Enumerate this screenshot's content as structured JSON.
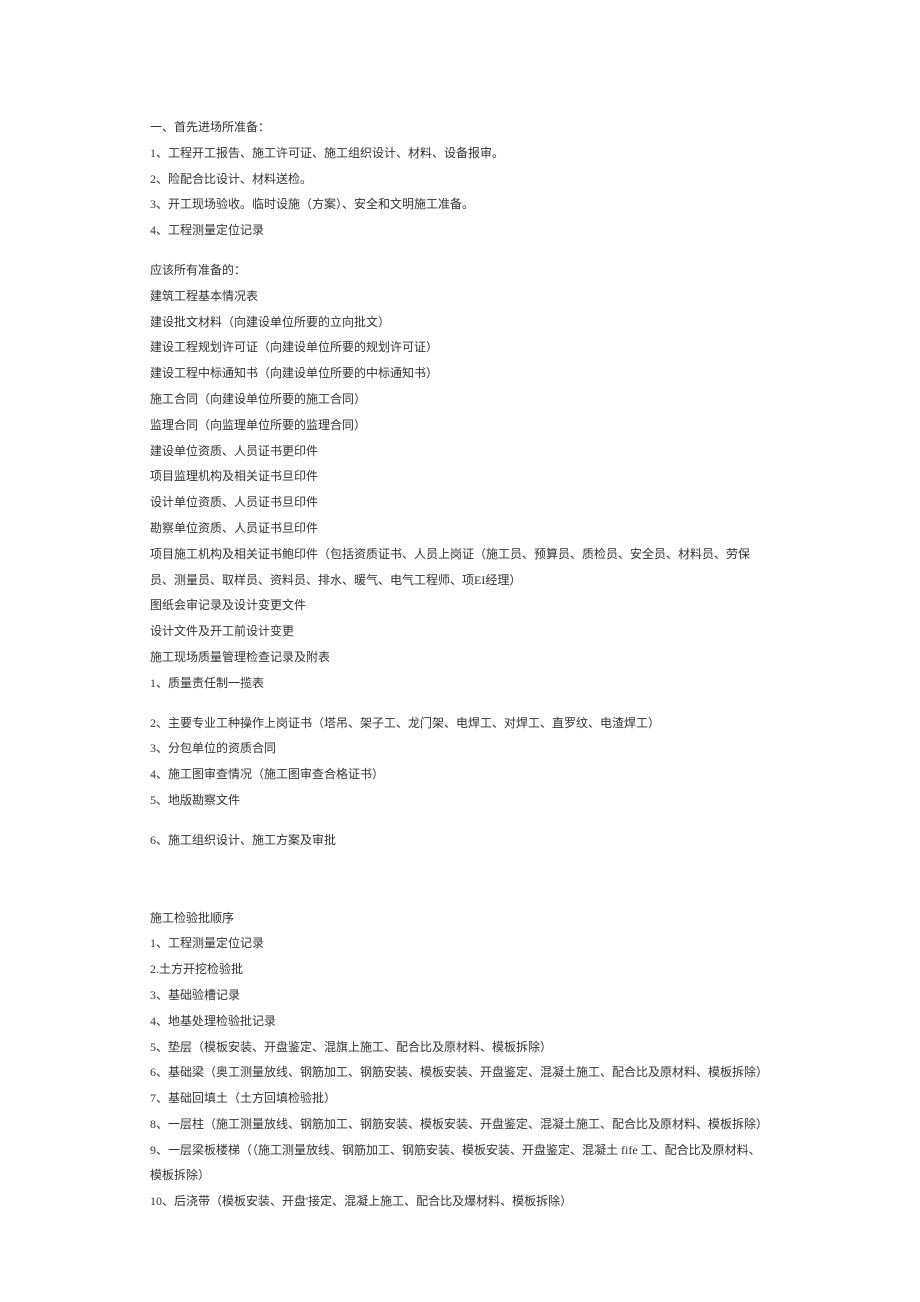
{
  "section1": {
    "title": "一、首先进场所准备：",
    "items": [
      "1、工程开工报告、施工许可证、施工组织设计、材料、设备报审。",
      "2、险配合比设计、材料送检。",
      "3、开工现场验收。临时设施（方案）、安全和文明施工准备。",
      "4、工程测量定位记录"
    ]
  },
  "section2": {
    "title": "应该所有准备的：",
    "items": [
      "建筑工程基本情况表",
      "建设批文材料（向建设单位所要的立向批文）",
      "建设工程规划许可证（向建设单位所要的规划许可证）",
      "建设工程中标通知书（向建设单位所要的中标通知书）",
      "施工合同（向建设单位所要的施工合同）",
      "监理合同（向监理单位所要的监理合同）",
      "建设单位资质、人员证书更印件",
      "项目监理机构及相关证书旦印件",
      "设计单位资质、人员证书旦印件",
      "勘察单位资质、人员证书旦印件",
      "项目施工机构及相关证书鲍印件（包括资质证书、人员上岗证（施工员、预算员、质检员、安全员、材料员、劳保员、测量员、取样员、资料员、排水、暖气、电气工程师、项EI经理）",
      "图纸会审记录及设计变更文件",
      "设计文件及开工前设计变更",
      "施工现场质量管理检查记录及附表",
      "1、质量责任制一揽表"
    ]
  },
  "section2b": {
    "items": [
      "2、主要专业工种操作上岗证书（塔吊、架子工、龙门架、电焊工、对焊工、直罗纹、电渣焊工）",
      "3、分包单位的资质合同",
      "4、施工图审查情况（施工图审查合格证书）",
      "5、地版勘察文件"
    ]
  },
  "section2c": {
    "items": [
      "6、施工组织设计、施工方案及审批"
    ]
  },
  "section3": {
    "title": "施工检验批顺序",
    "items": [
      "1、工程测量定位记录",
      "2.土方开挖检验批",
      "3、基础验槽记录",
      "4、地基处理检验批记录",
      "5、垫层（模板安装、开盘鉴定、混旗上施工、配合比及原材料、模板拆除）",
      "6、基础梁（奥工测量放线、钢筋加工、钢筋安装、模板安装、开盘鉴定、混凝土施工、配合比及原材料、模板拆除）",
      "7、基础回填土（土方回填检验批）",
      "8、一层柱（施工测量放线、钢筋加工、钢筋安装、模板安装、开盘鉴定、混凝土施工、配合比及原材料、模板拆除）",
      "9、一层梁板楼梯（（施工测量放线、钢筋加工、钢筋安装、模板安装、开盘鉴定、混凝土 fife 工、配合比及原材料、模板拆除）",
      "10、后浇带（模板安装、开盘'接定、混凝上施工、配合比及爆材料、模板拆除）"
    ]
  }
}
